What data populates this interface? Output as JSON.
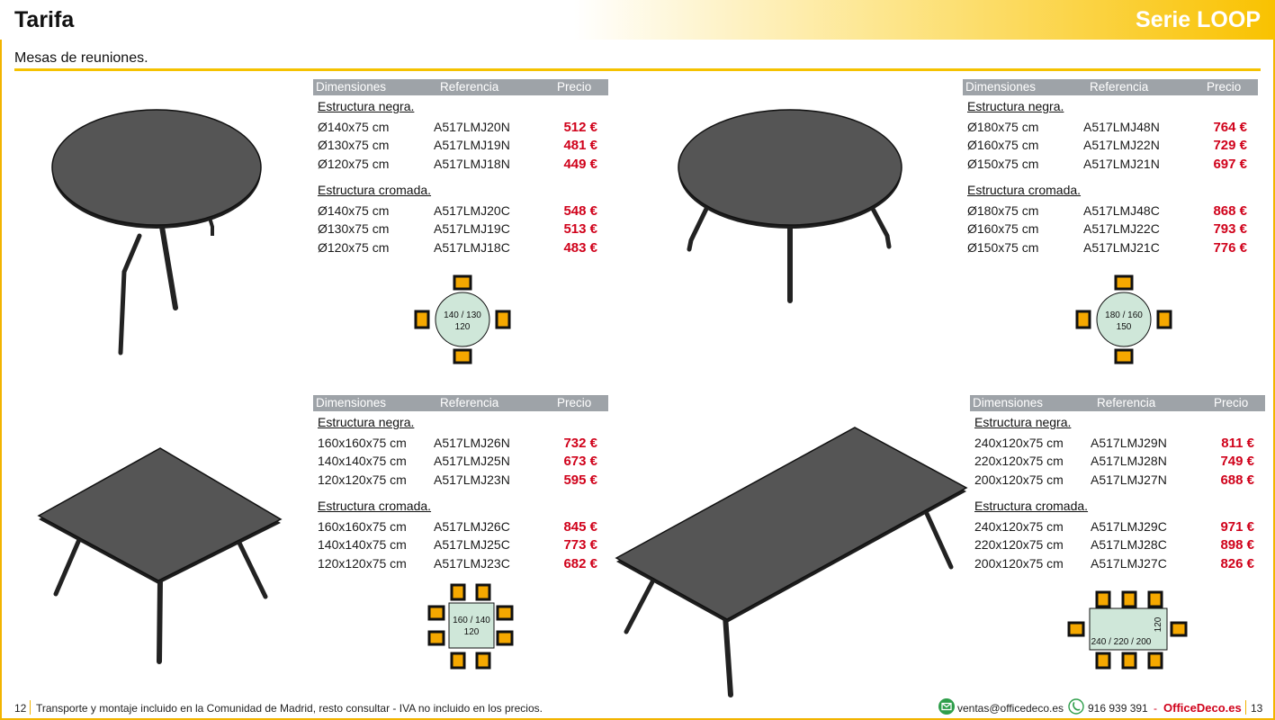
{
  "header": {
    "title": "Tarifa",
    "serie": "Serie LOOP"
  },
  "subtitle": "Mesas de reuniones.",
  "columns": {
    "dim": "Dimensiones",
    "ref": "Referencia",
    "price": "Precio"
  },
  "sections": {
    "black": "Estructura negra.",
    "chrome": "Estructura cromada."
  },
  "tables": [
    {
      "black": [
        {
          "dim": "Ø140x75 cm",
          "ref": "A517LMJ20N",
          "price": "512 €"
        },
        {
          "dim": "Ø130x75 cm",
          "ref": "A517LMJ19N",
          "price": "481 €"
        },
        {
          "dim": "Ø120x75 cm",
          "ref": "A517LMJ18N",
          "price": "449 €"
        }
      ],
      "chrome": [
        {
          "dim": "Ø140x75 cm",
          "ref": "A517LMJ20C",
          "price": "548 €"
        },
        {
          "dim": "Ø130x75 cm",
          "ref": "A517LMJ19C",
          "price": "513 €"
        },
        {
          "dim": "Ø120x75 cm",
          "ref": "A517LMJ18C",
          "price": "483 €"
        }
      ],
      "diagram": {
        "line1": "140 / 130",
        "line2": "120"
      }
    },
    {
      "black": [
        {
          "dim": "Ø180x75 cm",
          "ref": "A517LMJ48N",
          "price": "764 €"
        },
        {
          "dim": "Ø160x75 cm",
          "ref": "A517LMJ22N",
          "price": "729 €"
        },
        {
          "dim": "Ø150x75 cm",
          "ref": "A517LMJ21N",
          "price": "697 €"
        }
      ],
      "chrome": [
        {
          "dim": "Ø180x75 cm",
          "ref": "A517LMJ48C",
          "price": "868 €"
        },
        {
          "dim": "Ø160x75 cm",
          "ref": "A517LMJ22C",
          "price": "793 €"
        },
        {
          "dim": "Ø150x75 cm",
          "ref": "A517LMJ21C",
          "price": "776 €"
        }
      ],
      "diagram": {
        "line1": "180 / 160",
        "line2": "150"
      }
    },
    {
      "black": [
        {
          "dim": "160x160x75 cm",
          "ref": "A517LMJ26N",
          "price": "732 €"
        },
        {
          "dim": "140x140x75 cm",
          "ref": "A517LMJ25N",
          "price": "673 €"
        },
        {
          "dim": "120x120x75 cm",
          "ref": "A517LMJ23N",
          "price": "595 €"
        }
      ],
      "chrome": [
        {
          "dim": "160x160x75 cm",
          "ref": "A517LMJ26C",
          "price": "845 €"
        },
        {
          "dim": "140x140x75 cm",
          "ref": "A517LMJ25C",
          "price": "773 €"
        },
        {
          "dim": "120x120x75 cm",
          "ref": "A517LMJ23C",
          "price": "682 €"
        }
      ],
      "diagram": {
        "line1": "160 / 140",
        "line2": "120"
      }
    },
    {
      "black": [
        {
          "dim": "240x120x75 cm",
          "ref": "A517LMJ29N",
          "price": "811 €"
        },
        {
          "dim": "220x120x75 cm",
          "ref": "A517LMJ28N",
          "price": "749 €"
        },
        {
          "dim": "200x120x75 cm",
          "ref": "A517LMJ27N",
          "price": "688 €"
        }
      ],
      "chrome": [
        {
          "dim": "240x120x75 cm",
          "ref": "A517LMJ29C",
          "price": "971 €"
        },
        {
          "dim": "220x120x75 cm",
          "ref": "A517LMJ28C",
          "price": "898 €"
        },
        {
          "dim": "200x120x75 cm",
          "ref": "A517LMJ27C",
          "price": "826 €"
        }
      ],
      "diagram": {
        "line1": "240 / 220 / 200",
        "line2": "120"
      }
    }
  ],
  "footer": {
    "page_left": "12",
    "note": "Transporte y montaje incluido en la Comunidad de Madrid, resto consultar - IVA no incluido en los precios.",
    "email": "ventas@officedeco.es",
    "phone": "916 939 391",
    "dash": "-",
    "brand": "OfficeDeco.es",
    "page_right": "13",
    "mail_icon": "envelope-icon",
    "phone_icon": "phone-icon"
  },
  "colors": {
    "accent": "#f5c200",
    "price": "#d0021b",
    "table_header": "#9ea3a8",
    "diagram_fill": "#cfe7d9",
    "chair": "#f5a800"
  }
}
